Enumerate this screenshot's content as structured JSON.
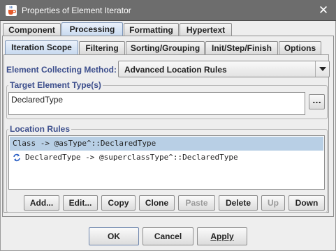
{
  "window": {
    "title": "Properties of Element Iterator",
    "app_icon": "java-cup-icon",
    "close_icon": "close-icon"
  },
  "main_tabs": [
    {
      "label": "Component",
      "selected": false
    },
    {
      "label": "Processing",
      "selected": true
    },
    {
      "label": "Formatting",
      "selected": false
    },
    {
      "label": "Hypertext",
      "selected": false
    }
  ],
  "sub_tabs": [
    {
      "label": "Iteration Scope",
      "selected": true
    },
    {
      "label": "Filtering",
      "selected": false
    },
    {
      "label": "Sorting/Grouping",
      "selected": false
    },
    {
      "label": "Init/Step/Finish",
      "selected": false
    },
    {
      "label": "Options",
      "selected": false
    }
  ],
  "collecting_method": {
    "label": "Element Collecting Method:",
    "value": "Advanced Location Rules",
    "arrow_icon": "chevron-down-icon"
  },
  "target_types": {
    "title": "Target Element Type(s)",
    "value": "DeclaredType",
    "browse_label": "..."
  },
  "location_rules": {
    "title": "Location Rules",
    "rules": [
      {
        "text": "Class -> @asType^::DeclaredType",
        "selected": true,
        "icon": ""
      },
      {
        "text": "DeclaredType -> @superclassType^::DeclaredType",
        "selected": false,
        "icon": "recursion-arrow-icon"
      }
    ],
    "buttons": [
      {
        "label": "Add...",
        "enabled": true
      },
      {
        "label": "Edit...",
        "enabled": true
      },
      {
        "label": "Copy",
        "enabled": true
      },
      {
        "label": "Clone",
        "enabled": true
      },
      {
        "label": "Paste",
        "enabled": false
      },
      {
        "label": "Delete",
        "enabled": true
      },
      {
        "label": "Up",
        "enabled": false
      },
      {
        "label": "Down",
        "enabled": true
      }
    ]
  },
  "dialog_buttons": {
    "ok": "OK",
    "cancel": "Cancel",
    "apply": "Apply"
  },
  "colors": {
    "titlebar": "#6d6d6d",
    "label_blue": "#3c4e8c",
    "selection": "#b8cfe5",
    "recursion_icon": "#2a5fc4"
  }
}
